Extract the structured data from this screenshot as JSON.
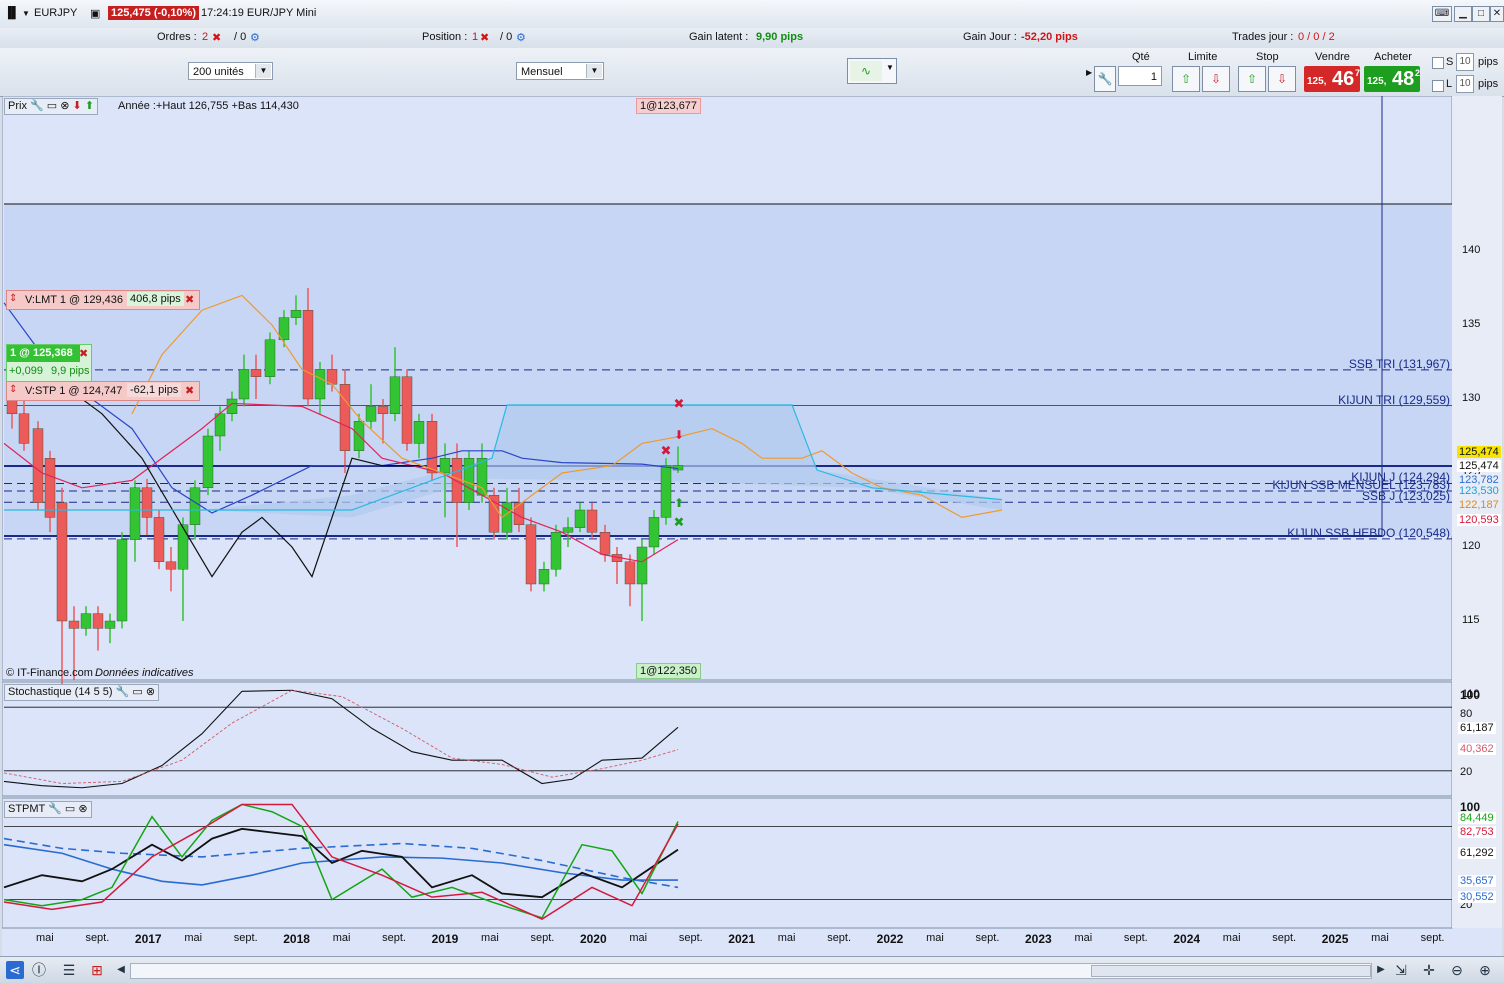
{
  "window": {
    "symbol": "EURJPY",
    "price_badge": "125,475 (-0,10%)",
    "title": "17:24:19 EUR/JPY Mini"
  },
  "orderbar": {
    "orders_label": "Ordres :",
    "orders_count": "2",
    "orders_zero": "/ 0",
    "position_label": "Position :",
    "position_count": "1",
    "position_zero": "/ 0",
    "gain_latent_label": "Gain latent :",
    "gain_latent_value": "9,90 pips",
    "gain_jour_label": "Gain Jour :",
    "gain_jour_value": "-52,20 pips",
    "trades_label": "Trades jour :",
    "trades_value": "0 / 0 / 2"
  },
  "toolbar": {
    "units_select": "200 unités",
    "period_select": "Mensuel",
    "qty_label": "Qté",
    "qty_value": "1",
    "limit_label": "Limite",
    "stop_label": "Stop",
    "sell_label": "Vendre",
    "buy_label": "Acheter",
    "sell_small": "125,",
    "sell_big": "46",
    "sell_sup": "7",
    "buy_small": "125,",
    "buy_big": "48",
    "buy_sup": "2",
    "s_label": "S",
    "l_label": "L",
    "s_pips_value": "10",
    "l_pips_value": "10",
    "pips_label": "pips"
  },
  "price_panel": {
    "header": "Prix",
    "info": "Année :+Haut 126,755 +Bas 114,430",
    "top_tag": "1@123,677",
    "bottom_tag": "1@122,350",
    "copyright": "© IT-Finance.com",
    "copyright_note": "Données indicatives",
    "limit_order": "V:LMT  1 @ 129,436",
    "limit_pips": "406,8 pips",
    "position_tag": "1 @ 125,368",
    "position_gain": "+0,099",
    "position_pips": "9,9 pips",
    "stop_order": "V:STP  1 @ 124,747",
    "stop_pips": "-62,1 pips",
    "y_ticks": [
      "140",
      "135",
      "130",
      "125",
      "120",
      "115",
      "110"
    ],
    "level_labels": [
      {
        "text": "SSB TRI (131,967)",
        "color": "#1a2a88"
      },
      {
        "text": "KIJUN TRI (129,559)",
        "color": "#1a2a88"
      },
      {
        "text": "KIJUN J (124,294)",
        "color": "#1a2a88"
      },
      {
        "text": "KIJUN SSB MENSUEL (123,783)",
        "color": "#1a2a88"
      },
      {
        "text": "SSB J (123,025)",
        "color": "#1a2a88"
      },
      {
        "text": "KIJUN SSB HEBDO (120,548)",
        "color": "#1a2a88"
      }
    ],
    "price_tags": [
      {
        "text": "125,474",
        "bg": "#f7e400",
        "fg": "#111"
      },
      {
        "text": "125,474",
        "bg": "#ffffff",
        "fg": "#111"
      },
      {
        "text": "123,782",
        "bg": "#e7ecf6",
        "fg": "#2a6bd1"
      },
      {
        "text": "123,530",
        "bg": "#e7ecf6",
        "fg": "#19a4d6"
      },
      {
        "text": "122,187",
        "bg": "#e7ecf6",
        "fg": "#e08a18"
      },
      {
        "text": "120,593",
        "bg": "#ffffff",
        "fg": "#d41a3c"
      }
    ]
  },
  "stoch_panel": {
    "header": "Stochastique (14 5 5)",
    "ticks": [
      "100",
      "80",
      "20"
    ],
    "value_main": "61,187",
    "value_signal": "40,362"
  },
  "stpmt_panel": {
    "header": "STPMT",
    "ticks": [
      "100",
      "20"
    ],
    "values": [
      {
        "text": "84,449",
        "fg": "#14a514"
      },
      {
        "text": "82,753",
        "fg": "#d41a3c"
      },
      {
        "text": "61,292",
        "fg": "#111111"
      },
      {
        "text": "35,657",
        "fg": "#2a6bd1"
      },
      {
        "text": "30,552",
        "fg": "#2a6bd1"
      }
    ]
  },
  "time_axis": [
    "mai",
    "sept.",
    "2017",
    "mai",
    "sept.",
    "2018",
    "mai",
    "sept.",
    "2019",
    "mai",
    "sept.",
    "2020",
    "mai",
    "sept.",
    "2021",
    "mai",
    "sept.",
    "2022",
    "mai",
    "sept.",
    "2023",
    "mai",
    "sept.",
    "2024",
    "mai",
    "sept.",
    "2025",
    "mai",
    "sept."
  ],
  "colors": {
    "bull": "#33c433",
    "bear": "#ec5a5a",
    "cloud": "#bcd2f2",
    "accent_red": "#c51f1f",
    "accent_green": "#1e9e1e"
  }
}
